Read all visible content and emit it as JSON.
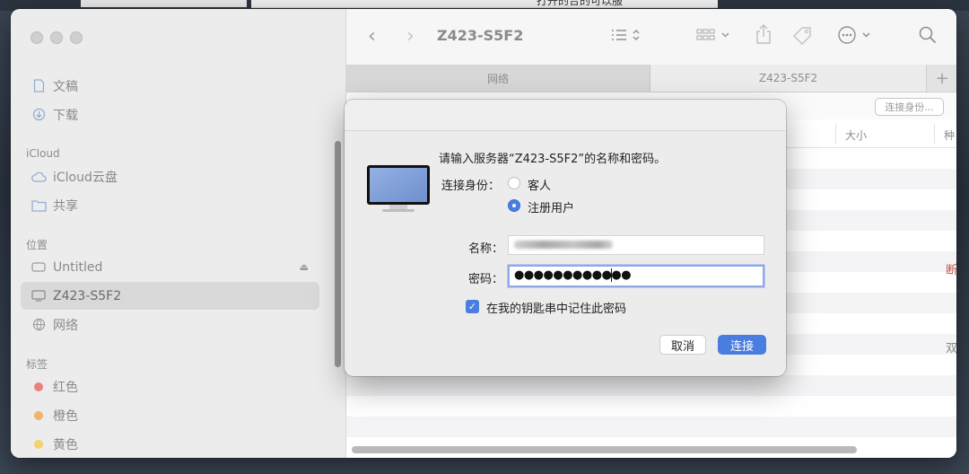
{
  "background_partial_text": "打开的合的可以服",
  "window": {
    "title": "Z423-S5F2",
    "tabs": [
      "网络",
      "Z423-S5F2"
    ],
    "tab_add": "+",
    "connect_as_button": "连接身份...",
    "columns": [
      "大小",
      "种"
    ],
    "partial_side_text": [
      "断",
      "双"
    ]
  },
  "sidebar": {
    "favorites": [
      {
        "label": "文稿",
        "icon": "document-icon"
      },
      {
        "label": "下载",
        "icon": "download-icon"
      }
    ],
    "icloud_header": "iCloud",
    "icloud": [
      {
        "label": "iCloud云盘",
        "icon": "cloud-icon"
      },
      {
        "label": "共享",
        "icon": "shared-folder-icon"
      }
    ],
    "locations_header": "位置",
    "locations": [
      {
        "label": "Untitled",
        "icon": "drive-icon"
      },
      {
        "label": "Z423-S5F2",
        "icon": "display-icon"
      },
      {
        "label": "网络",
        "icon": "network-icon"
      }
    ],
    "tags_header": "标签",
    "tags": [
      {
        "label": "红色",
        "color": "#e8837c"
      },
      {
        "label": "橙色",
        "color": "#f0b36a"
      },
      {
        "label": "黄色",
        "color": "#f3d26b"
      }
    ]
  },
  "dialog": {
    "prompt": "请输入服务器“Z423-S5F2”的名称和密码。",
    "connect_as_label": "连接身份：",
    "options": [
      "客人",
      "注册用户"
    ],
    "selected_option": "注册用户",
    "name_label": "名称：",
    "password_label": "密码：",
    "password_value": "●●●●●●●●●●●●",
    "remember_label": "在我的钥匙串中记住此密码",
    "remember_checked": true,
    "cancel_label": "取消",
    "connect_label": "连接",
    "accent_color": "#4a7de0"
  }
}
